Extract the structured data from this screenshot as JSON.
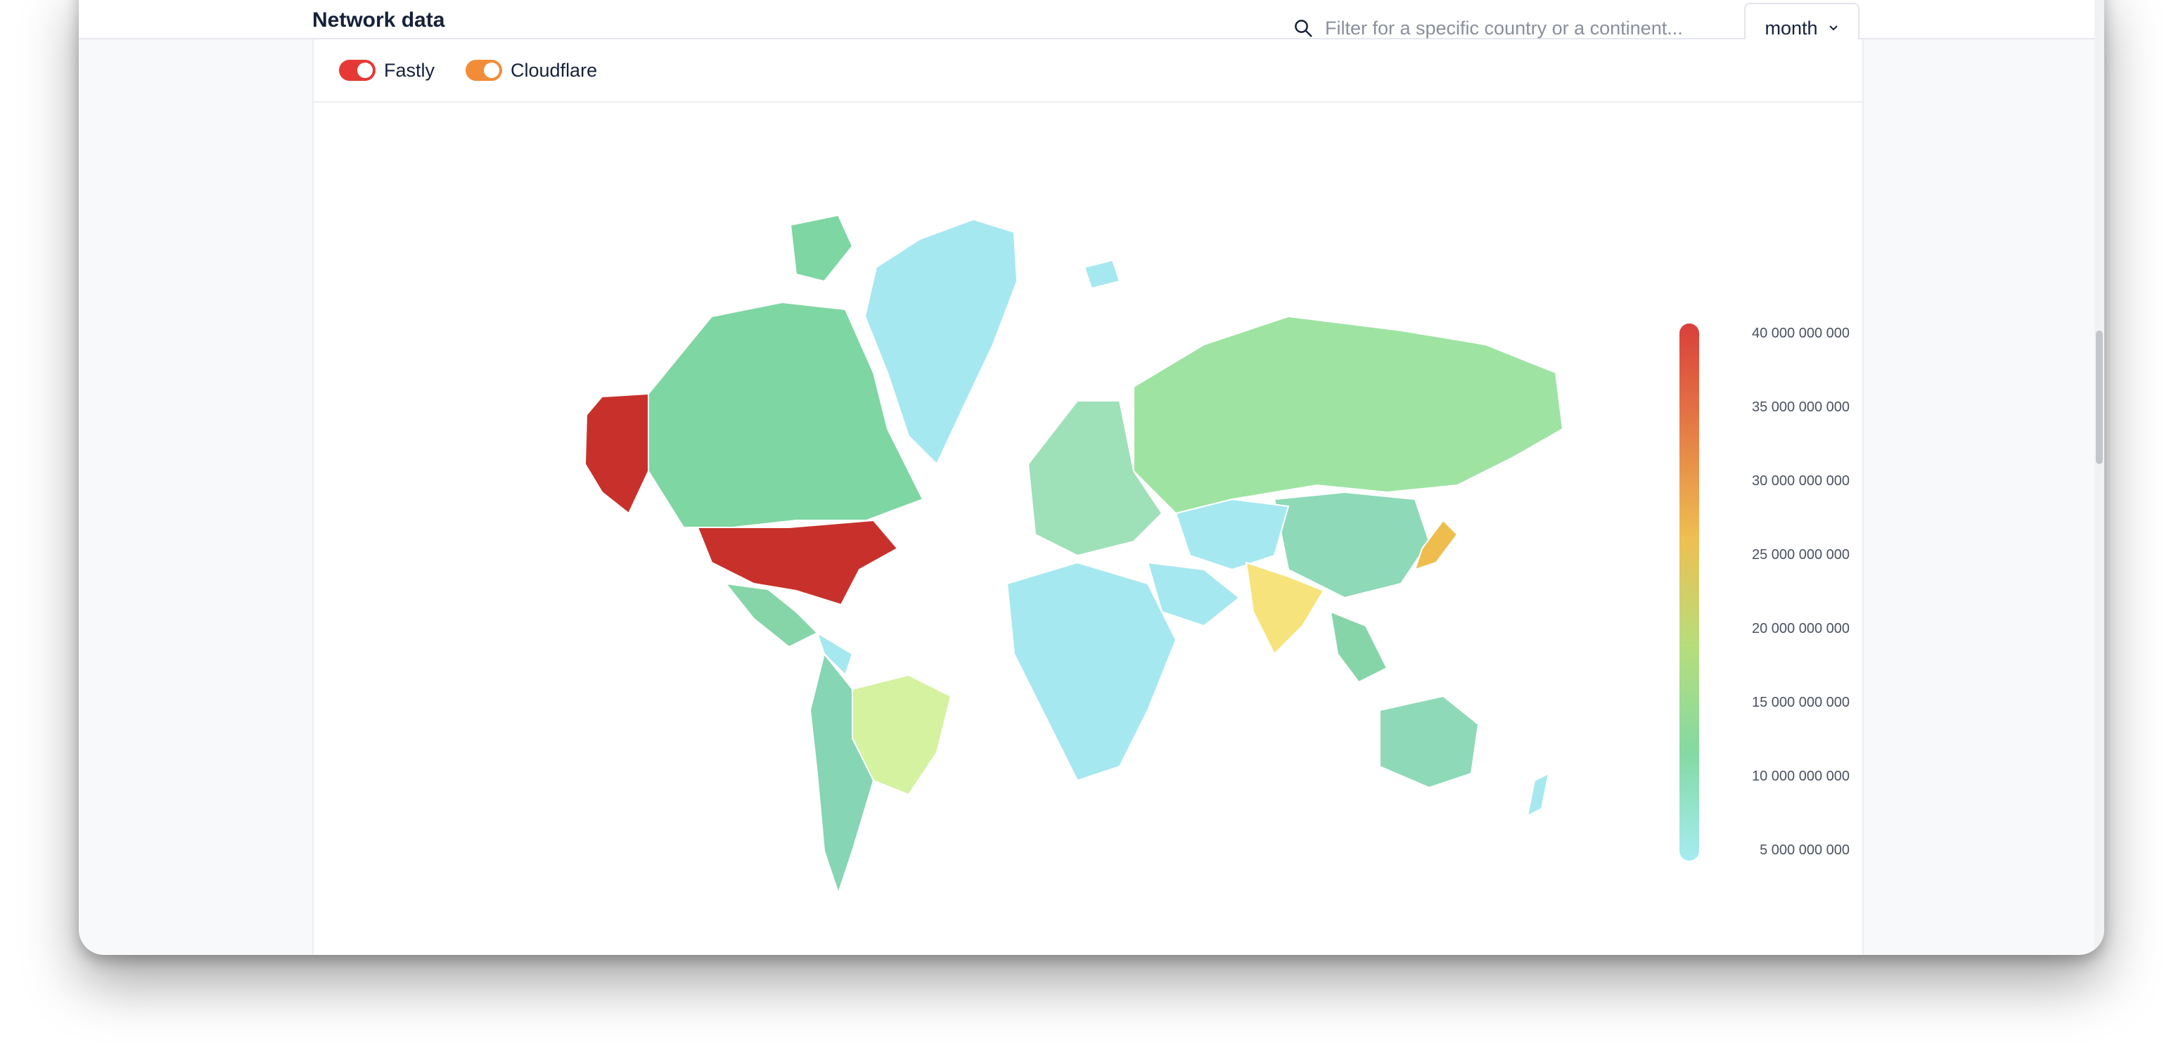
{
  "header": {
    "title": "Network data",
    "search_placeholder": "Filter for a specific country or a continent...",
    "period": "month"
  },
  "providers": [
    {
      "label": "Fastly",
      "color": "#e53935"
    },
    {
      "label": "Cloudflare",
      "color": "#f28c38"
    }
  ],
  "legend": {
    "labels": [
      "40 000 000 000",
      "35 000 000 000",
      "30 000 000 000",
      "25 000 000 000",
      "20 000 000 000",
      "15 000 000 000",
      "10 000 000 000",
      "5 000 000 000"
    ],
    "colors": [
      "#d93f3b",
      "#e57d46",
      "#eebf52",
      "#b7dd7c",
      "#84d9a2",
      "#a6ecf2"
    ]
  },
  "icons": {
    "search": "search-icon",
    "chevron": "chevron-down-icon"
  }
}
